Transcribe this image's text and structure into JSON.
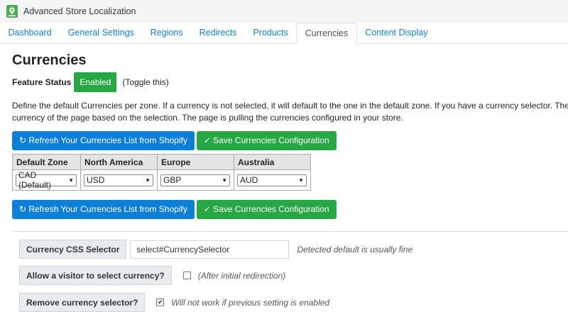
{
  "app": {
    "title": "Advanced Store Localization",
    "icon": "map-pin-icon",
    "icon_color": "#4caf50"
  },
  "tabs": [
    {
      "label": "Dashboard",
      "active": false
    },
    {
      "label": "General Settings",
      "active": false
    },
    {
      "label": "Regions",
      "active": false
    },
    {
      "label": "Redirects",
      "active": false
    },
    {
      "label": "Products",
      "active": false
    },
    {
      "label": "Currencies",
      "active": true
    },
    {
      "label": "Content Display",
      "active": false
    }
  ],
  "page": {
    "title": "Currencies",
    "feature_status_label": "Feature Status",
    "feature_status_value": "Enabled",
    "toggle_text": "(Toggle this)",
    "description_line1": "Define the default Currencies per zone. If a currency is not selected, it will default to the one in the default zone. If you have a currency selector. The app will au",
    "description_line2": "currency of the page based on the selection. The page is pulling the currencies configured in your store."
  },
  "buttons": {
    "refresh_label": "↻ Refresh Your Currencies List from Shopify",
    "save_label": "✓ Save Currencies Configuration"
  },
  "zones_table": {
    "headers": [
      "Default Zone",
      "North America",
      "Europe",
      "Australia"
    ],
    "values": [
      "CAD (Default)",
      "USD",
      "GBP",
      "AUD"
    ]
  },
  "settings": {
    "css_selector": {
      "label": "Currency CSS Selector",
      "value": "select#CurrencySelector",
      "hint": "Detected default is usually fine"
    },
    "allow_select": {
      "label": "Allow a visitor to select currency?",
      "checked": false,
      "hint": "(After initial redirection)"
    },
    "remove_selector": {
      "label": "Remove currency selector?",
      "checked": true,
      "check_glyph": "✔",
      "hint": "Will not work if previous setting is enabled"
    }
  },
  "colors": {
    "primary": "#0d7fd6",
    "success": "#28a745"
  }
}
